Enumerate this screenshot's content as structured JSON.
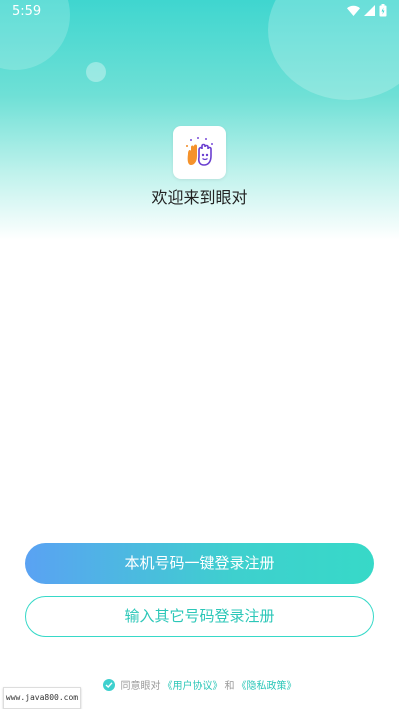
{
  "status_bar": {
    "time": "5:59",
    "icons": [
      "wifi-icon",
      "signal-icon",
      "battery-icon"
    ]
  },
  "app": {
    "logo_icon": "hand-logo-icon",
    "welcome_text": "欢迎来到眼对"
  },
  "actions": {
    "one_click_login": "本机号码一键登录注册",
    "other_number_login": "输入其它号码登录注册"
  },
  "agreement": {
    "checked": true,
    "prefix": "同意眼对",
    "user_agreement": "《用户协议》",
    "and": "和",
    "privacy_policy": "《隐私政策》"
  },
  "watermark": {
    "text": "www.java800.com"
  },
  "colors": {
    "accent": "#37d9c8",
    "gradient_start": "#5aa2f3",
    "header_teal": "#3fd6cf"
  }
}
